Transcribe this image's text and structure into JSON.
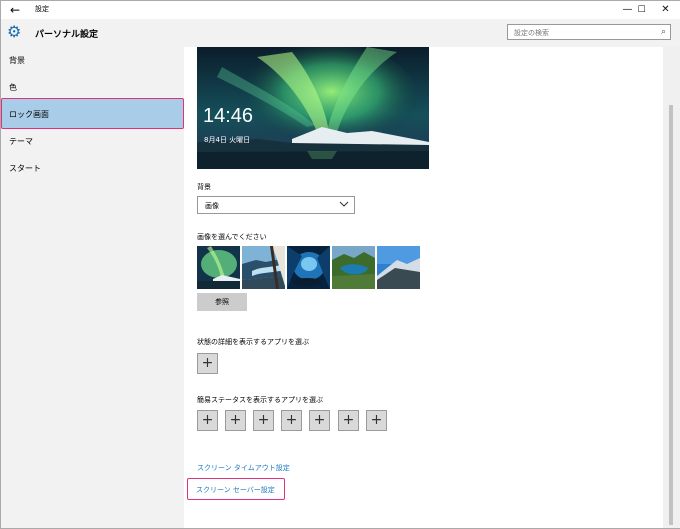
{
  "window": {
    "app_title": "設定",
    "back_glyph": "←",
    "minimize_glyph": "—",
    "maximize_glyph": "☐",
    "close_glyph": "✕"
  },
  "header": {
    "page_title": "パーソナル設定",
    "search_placeholder": "設定の検索",
    "gear_icon": "⚙",
    "search_icon": "⌕"
  },
  "sidebar": {
    "items": [
      {
        "label": "背景"
      },
      {
        "label": "色"
      },
      {
        "label": "ロック画面"
      },
      {
        "label": "テーマ"
      },
      {
        "label": "スタート"
      }
    ],
    "active_index": 2
  },
  "main": {
    "preview": {
      "time": "14:46",
      "date": "8月4日 火曜日"
    },
    "background_label": "背景",
    "background_value": "画像",
    "choose_image_label": "画像を選んでください",
    "browse_label": "参照",
    "detailed_status_label": "状態の詳細を表示するアプリを選ぶ",
    "quick_status_label": "簡易ステータスを表示するアプリを選ぶ",
    "plus_glyph": "+",
    "quick_status_slots": 7,
    "timeout_link": "スクリーン タイムアウト設定",
    "screensaver_link": "スクリーン セーバー設定"
  },
  "colors": {
    "accent_link": "#1a78c2",
    "selection_bg": "#a9cde9",
    "highlight_outline": "#e0317a"
  }
}
